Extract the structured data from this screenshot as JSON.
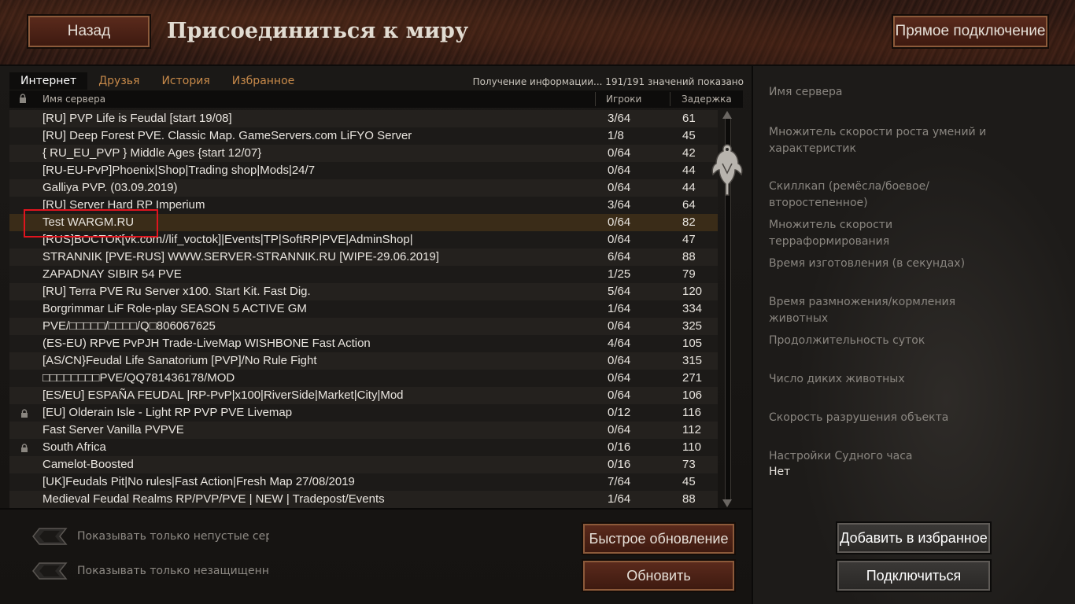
{
  "header": {
    "back_label": "Назад",
    "title": "Присоединиться к миру",
    "direct_connect_label": "Прямое подключение"
  },
  "tabs": [
    "Интернет",
    "Друзья",
    "История",
    "Избранное"
  ],
  "status_text": "Получение информации... 191/191 значений показано",
  "columns": {
    "name": "Имя сервера",
    "players": "Игроки",
    "ping": "Задержка"
  },
  "servers": [
    {
      "name": "[RU] PVP Life is Feudal [start 19/08]",
      "players": "3/64",
      "ping": "61",
      "locked": false
    },
    {
      "name": "[RU] Deep Forest PVE. Classic Map. GameServers.com LiFYO Server",
      "players": "1/8",
      "ping": "45",
      "locked": false
    },
    {
      "name": "{ RU_EU_PVP } Middle  Ages {start 12/07}",
      "players": "0/64",
      "ping": "42",
      "locked": false
    },
    {
      "name": "[RU-EU-PvP]Phoenix|Shop|Trading shop|Mods|24/7",
      "players": "0/64",
      "ping": "44",
      "locked": false
    },
    {
      "name": "Galliya PVP. (03.09.2019)",
      "players": "0/64",
      "ping": "44",
      "locked": false
    },
    {
      "name": "[RU] Server Hard RP Imperium",
      "players": "3/64",
      "ping": "64",
      "locked": false
    },
    {
      "name": "Test WARGM.RU",
      "players": "0/64",
      "ping": "82",
      "locked": false,
      "selected": true
    },
    {
      "name": "[RUS]ВОСТОК[vk.com//lif_voctok]|Events|TP|SoftRP|PVE|AdminShop|",
      "players": "0/64",
      "ping": "47",
      "locked": false
    },
    {
      "name": "STRANNIK [PVE-RUS] WWW.SERVER-STRANNIK.RU [WIPE-29.06.2019]",
      "players": "6/64",
      "ping": "88",
      "locked": false
    },
    {
      "name": "ZAPADNAY SIBIR 54 PVE",
      "players": "1/25",
      "ping": "79",
      "locked": false
    },
    {
      "name": "[RU] Terra PVE Ru Server x100. Start Kit. Fast Dig.",
      "players": "5/64",
      "ping": "120",
      "locked": false
    },
    {
      "name": " Borgrimmar LiF Role-play SEASON 5 ACTIVE GM",
      "players": "1/64",
      "ping": "334",
      "locked": false
    },
    {
      "name": "PVE/□□□□□/□□□□/Q□806067625",
      "players": "0/64",
      "ping": "325",
      "locked": false
    },
    {
      "name": "(ES-EU) RPvE PvPJH Trade-LiveMap WISHBONE Fast Action",
      "players": "4/64",
      "ping": "105",
      "locked": false
    },
    {
      "name": "[AS/CN}Feudal Life Sanatorium [PVP]/No Rule Fight",
      "players": "0/64",
      "ping": "315",
      "locked": false
    },
    {
      "name": "□□□□□□□□PVE/QQ781436178/MOD",
      "players": "0/64",
      "ping": "271",
      "locked": false
    },
    {
      "name": "[ES/EU] ESPAÑA FEUDAL |RP-PvP|x100|RiverSide|Market|City|Mod",
      "players": "0/64",
      "ping": "106",
      "locked": false
    },
    {
      "name": "[EU] Olderain Isle - Light RP  PVP  PVE  Livemap",
      "players": "0/12",
      "ping": "116",
      "locked": true
    },
    {
      "name": "Fast Server Vanilla PVPVE",
      "players": "0/64",
      "ping": "112",
      "locked": false
    },
    {
      "name": "South Africa",
      "players": "0/16",
      "ping": "110",
      "locked": true
    },
    {
      "name": "Camelot-Boosted",
      "players": "0/16",
      "ping": "73",
      "locked": false
    },
    {
      "name": "[UK]Feudals Pit|No rules|Fast Action|Fresh Map 27/08/2019",
      "players": "7/64",
      "ping": "45",
      "locked": false
    },
    {
      "name": "Medieval Feudal Realms RP/PVP/PVE | NEW | Tradepost/Events",
      "players": "1/64",
      "ping": "88",
      "locked": false
    }
  ],
  "filters": {
    "non_empty_label": "Показывать только непустые серв",
    "unprotected_label": "Показывать только незащищенн"
  },
  "buttons": {
    "quick_refresh": "Быстрое обновление",
    "refresh": "Обновить",
    "add_favorite": "Добавить в избранное",
    "connect": "Подключиться"
  },
  "server_info": {
    "name_label": "Имя сервера",
    "skill_speed_label": "Множитель скорости роста умений и характеристик",
    "skillcap_label": "Скиллкап (ремёсла/боевое/второстепенное)",
    "terraform_label": "Множитель скорости терраформирования",
    "craft_time_label": "Время изготовления (в секундах)",
    "breeding_label": "Время размножения/кормления животных",
    "day_length_label": "Продолжительность суток",
    "wild_animals_label": "Число диких животных",
    "decay_label": "Скорость разрушения объекта",
    "doom_label": "Настройки Судного часа",
    "doom_value": "Нет"
  }
}
